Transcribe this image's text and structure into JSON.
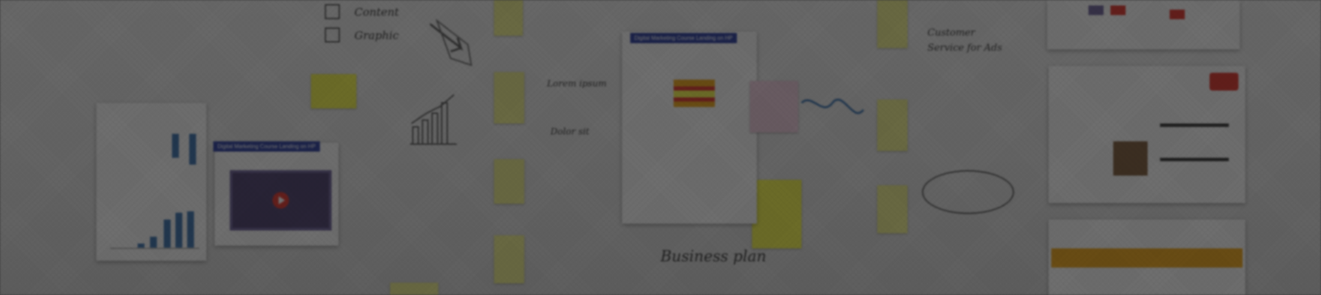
{
  "hero": {
    "scene": "whiteboard-collage",
    "video_card_title": "Digital Marketing Course Landing on HP",
    "center_card_title": "Digital Marketing Course Landing on HP",
    "handwriting": {
      "content_label": "Content",
      "graphic_label": "Graphic",
      "business_plan": "Business plan",
      "hands_lines": [
        "Lorem ipsum",
        "Dolor sit"
      ],
      "notes_right": [
        "Customer",
        "Service for Ads"
      ]
    },
    "colors": {
      "overlay": "#141414",
      "banner_blue": "#2a3d9a",
      "sticky_yellow": "#e9e98a",
      "sticky_bright": "#f0f04a",
      "red_badge": "#d9342b",
      "orange_bar": "#e9a21a",
      "chart_blue": "#3a6fa8"
    }
  }
}
